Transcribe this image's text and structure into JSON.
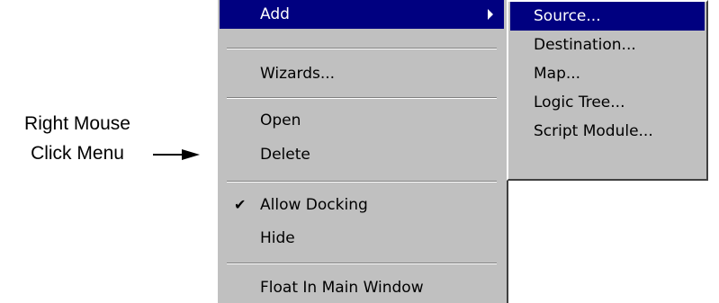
{
  "annotation": {
    "line1": "Right Mouse",
    "line2": "Click Menu"
  },
  "context_menu": {
    "add": "Add",
    "wizards": "Wizards...",
    "open": "Open",
    "delete": "Delete",
    "allow_docking": "Allow Docking",
    "allow_docking_checked": true,
    "check_glyph": "✔",
    "hide": "Hide",
    "float_in_main_window": "Float In Main Window"
  },
  "add_submenu": {
    "items": [
      "Source...",
      "Destination...",
      "Map...",
      "Logic Tree...",
      "Script Module..."
    ],
    "highlighted_index": 0
  },
  "colors": {
    "menu_face": "#c0c0c0",
    "highlight": "#000080",
    "highlight_text": "#ffffff"
  },
  "icons": {
    "submenu_arrow": "triangle-right-icon",
    "checkmark": "checkmark-icon",
    "pointer_arrow": "arrow-right-icon"
  }
}
